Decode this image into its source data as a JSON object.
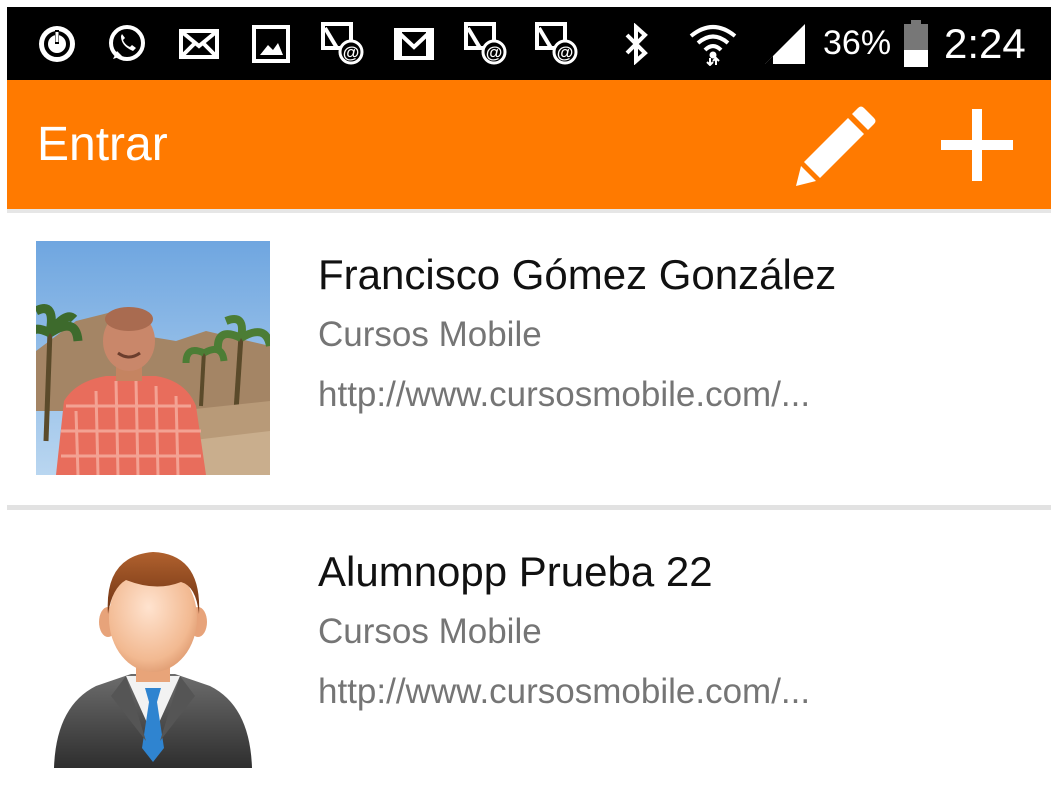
{
  "status_bar": {
    "battery_percent": "36%",
    "time": "2:24",
    "icons": [
      "sync-icon",
      "whatsapp-icon",
      "mail-icon",
      "gallery-icon",
      "email-at-icon",
      "gmail-icon",
      "email-at-icon",
      "email-at-icon",
      "bluetooth-icon",
      "wifi-icon",
      "signal-icon",
      "battery-icon"
    ]
  },
  "app_bar": {
    "title": "Entrar",
    "edit_icon": "pencil-icon",
    "add_icon": "plus-icon",
    "color": "#ff7a00"
  },
  "contacts": [
    {
      "name": "Francisco Gómez González",
      "company": "Cursos Mobile",
      "url": "http://www.cursosmobile.com/..."
    },
    {
      "name": "Alumnopp Prueba 22",
      "company": "Cursos Mobile",
      "url": "http://www.cursosmobile.com/..."
    }
  ]
}
